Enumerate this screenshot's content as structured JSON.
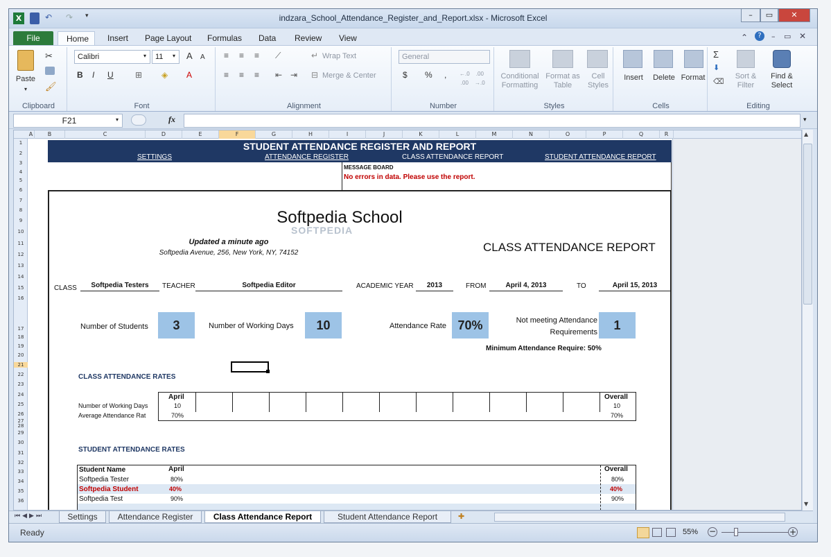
{
  "window": {
    "title": "indzara_School_Attendance_Register_and_Report.xlsx - Microsoft Excel",
    "min": "–",
    "max": "▭",
    "close": "✕"
  },
  "ribbon": {
    "tabs": [
      "File",
      "Home",
      "Insert",
      "Page Layout",
      "Formulas",
      "Data",
      "Review",
      "View"
    ],
    "clipboard": {
      "paste": "Paste",
      "label": "Clipboard"
    },
    "font": {
      "name": "Calibri",
      "size": "11",
      "label": "Font",
      "bold": "B",
      "italic": "I",
      "underline": "U",
      "grow": "A",
      "shrink": "A"
    },
    "alignment": {
      "wrap": "Wrap Text",
      "merge": "Merge & Center",
      "label": "Alignment"
    },
    "number": {
      "format": "General",
      "currency": "$",
      "percent": "%",
      "comma": ",",
      "label": "Number"
    },
    "styles": {
      "conditional": "Conditional Formatting",
      "table": "Format as Table",
      "cell": "Cell Styles",
      "label": "Styles"
    },
    "cells": {
      "insert": "Insert",
      "delete": "Delete",
      "format": "Format",
      "label": "Cells"
    },
    "editing": {
      "sort": "Sort & Filter",
      "find": "Find & Select",
      "label": "Editing"
    }
  },
  "formula_bar": {
    "name_box": "F21",
    "fx": "fx",
    "formula": ""
  },
  "columns": [
    "A",
    "B",
    "C",
    "D",
    "E",
    "F",
    "G",
    "H",
    "I",
    "J",
    "K",
    "L",
    "M",
    "N",
    "O",
    "P",
    "Q",
    "R"
  ],
  "rows": [
    "1",
    "2",
    "3",
    "4",
    "5",
    "6",
    "7",
    "8",
    "9",
    "10",
    "11",
    "12",
    "13",
    "14",
    "15",
    "16",
    "17",
    "18",
    "19",
    "20",
    "21",
    "22",
    "23",
    "24",
    "25",
    "26",
    "27",
    "28",
    "29",
    "30",
    "31",
    "32",
    "33",
    "34",
    "35",
    "36"
  ],
  "report": {
    "header_title": "STUDENT ATTENDANCE REGISTER AND REPORT",
    "nav": [
      "SETTINGS",
      "ATTENDANCE REGISTER",
      "CLASS ATTENDANCE REPORT",
      "STUDENT ATTENDANCE REPORT"
    ],
    "message_board_label": "MESSAGE BOARD",
    "message": "No errors in data. Please use the report.",
    "school_name": "Softpedia School",
    "updated": "Updated a minute ago",
    "address": "Softpedia Avenue, 256, New York, NY, 74152",
    "report_title": "CLASS ATTENDANCE REPORT",
    "class_label": "CLASS",
    "class_value": "Softpedia Testers",
    "teacher_label": "TEACHER",
    "teacher_value": "Softpedia Editor",
    "year_label": "ACADEMIC YEAR",
    "year_value": "2013",
    "from_label": "FROM",
    "from_value": "April 4, 2013",
    "to_label": "TO",
    "to_value": "April 15, 2013",
    "kpis": [
      {
        "label": "Number of Students",
        "value": "3"
      },
      {
        "label": "Number of Working Days",
        "value": "10"
      },
      {
        "label": "Attendance Rate",
        "value": "70%"
      },
      {
        "label": "Not meeting Attendance Requirements",
        "value": "1"
      }
    ],
    "min_attendance": "Minimum Attendance Require: 50%",
    "class_rates_title": "CLASS ATTENDANCE RATES",
    "class_rates": {
      "month": "April",
      "overall": "Overall",
      "rows": [
        {
          "label": "Number of Working Days",
          "month": "10",
          "overall": "10"
        },
        {
          "label": "Average Attendance Rat",
          "month": "70%",
          "overall": "70%"
        }
      ]
    },
    "student_rates_title": "STUDENT ATTENDANCE RATES",
    "student_rates": {
      "name_header": "Student Name",
      "month": "April",
      "overall": "Overall",
      "rows": [
        {
          "name": "Softpedia Tester",
          "month": "80%",
          "overall": "80%",
          "flag": false
        },
        {
          "name": "Softpedia Student",
          "month": "40%",
          "overall": "40%",
          "flag": true
        },
        {
          "name": "Softpedia Test",
          "month": "90%",
          "overall": "90%",
          "flag": false
        }
      ]
    },
    "watermark": "SOFTPEDIA"
  },
  "sheet_tabs": [
    "Settings",
    "Attendance Register",
    "Class Attendance Report",
    "Student Attendance Report"
  ],
  "active_sheet": "Class Attendance Report",
  "status": {
    "ready": "Ready",
    "zoom": "55%"
  },
  "colors": {
    "navy": "#1f3864",
    "kpi_box": "#9dc3e6",
    "alert_red": "#c00000",
    "ribbon_blue": "#dfe8f4",
    "file_green": "#2c7b3b"
  }
}
